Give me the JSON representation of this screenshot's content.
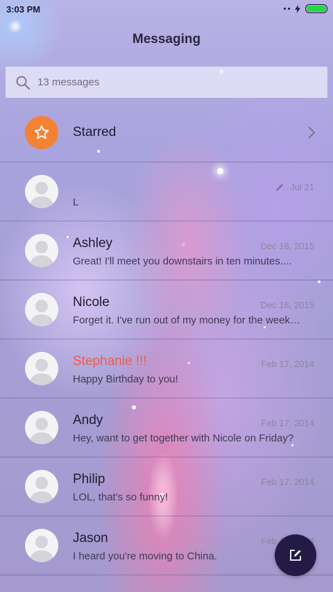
{
  "status_bar": {
    "time": "3:03 PM",
    "battery_color": "#27d649"
  },
  "header": {
    "title": "Messaging"
  },
  "search": {
    "placeholder": "13 messages",
    "icon": "search-icon"
  },
  "starred": {
    "label": "Starred",
    "badge_color": "#f48234",
    "icon": "star-icon"
  },
  "conversations": [
    {
      "name": "",
      "date": "Jul 21",
      "snippet": "L",
      "draft": true
    },
    {
      "name": "Ashley",
      "date": "Dec 16, 2015",
      "snippet": "Great! I'll meet you downstairs in ten minutes....",
      "draft": false
    },
    {
      "name": "Nicole",
      "date": "Dec 16, 2015",
      "snippet": "Forget it. I've run out of my money for the week…",
      "draft": false
    },
    {
      "name": "Stephanie !!!",
      "date": "Feb 17, 2014",
      "snippet": "Happy Birthday to you!",
      "draft": false,
      "highlight_color": "#ee5b4a"
    },
    {
      "name": "Andy",
      "date": "Feb 17, 2014",
      "snippet": "Hey, want to get together with Nicole on Friday?",
      "draft": false
    },
    {
      "name": "Philip",
      "date": "Feb 17, 2014",
      "snippet": "LOL, that's so funny!",
      "draft": false
    },
    {
      "name": "Jason",
      "date": "Feb 17, 2014",
      "snippet": "I heard you're moving to China.",
      "draft": false
    }
  ],
  "compose": {
    "icon": "compose-icon",
    "color": "#231a45"
  }
}
